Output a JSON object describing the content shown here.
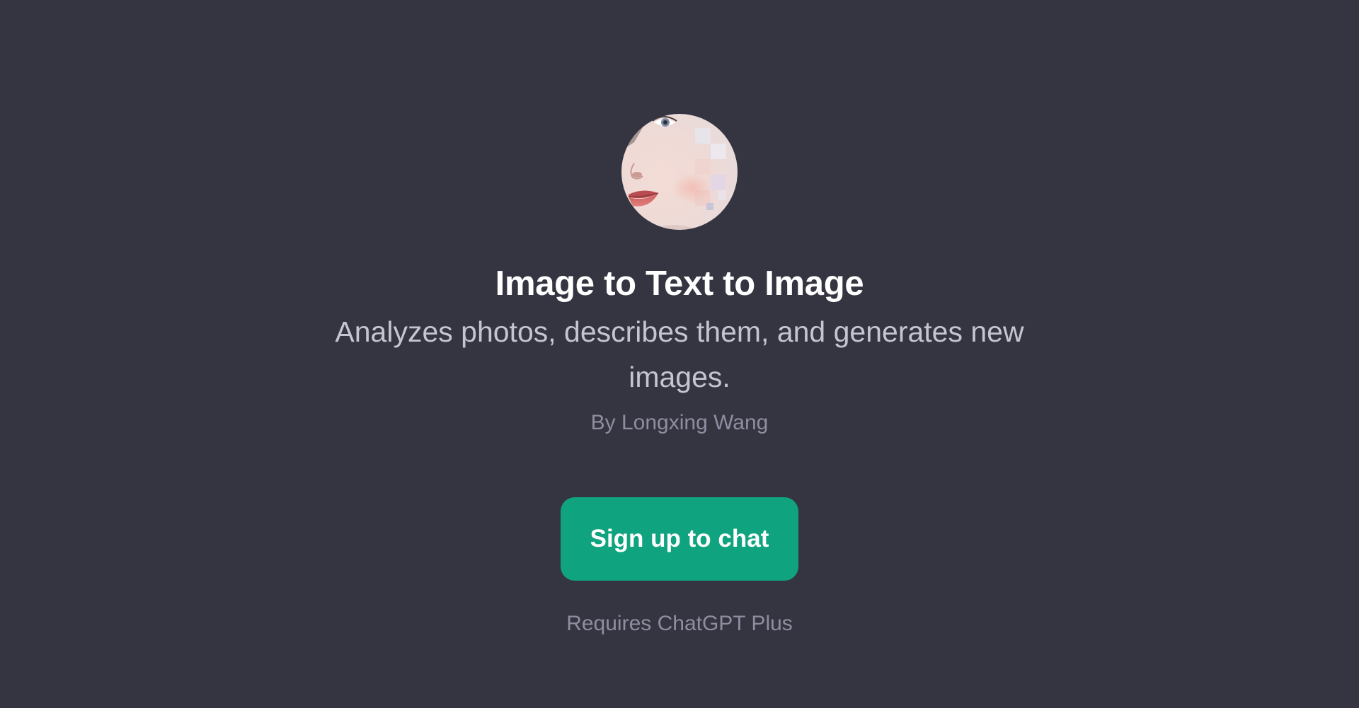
{
  "gpt": {
    "avatar_icon": "portrait-avatar-image",
    "title": "Image to Text to Image",
    "description": "Analyzes photos, describes them, and generates new images.",
    "author": "By Longxing Wang"
  },
  "cta": {
    "signup_label": "Sign up to chat",
    "requirement": "Requires ChatGPT Plus"
  },
  "colors": {
    "background": "#343541",
    "title": "#ffffff",
    "description": "#c5c5d2",
    "muted": "#8e8ea0",
    "button": "#10a37f",
    "button_text": "#ffffff"
  }
}
